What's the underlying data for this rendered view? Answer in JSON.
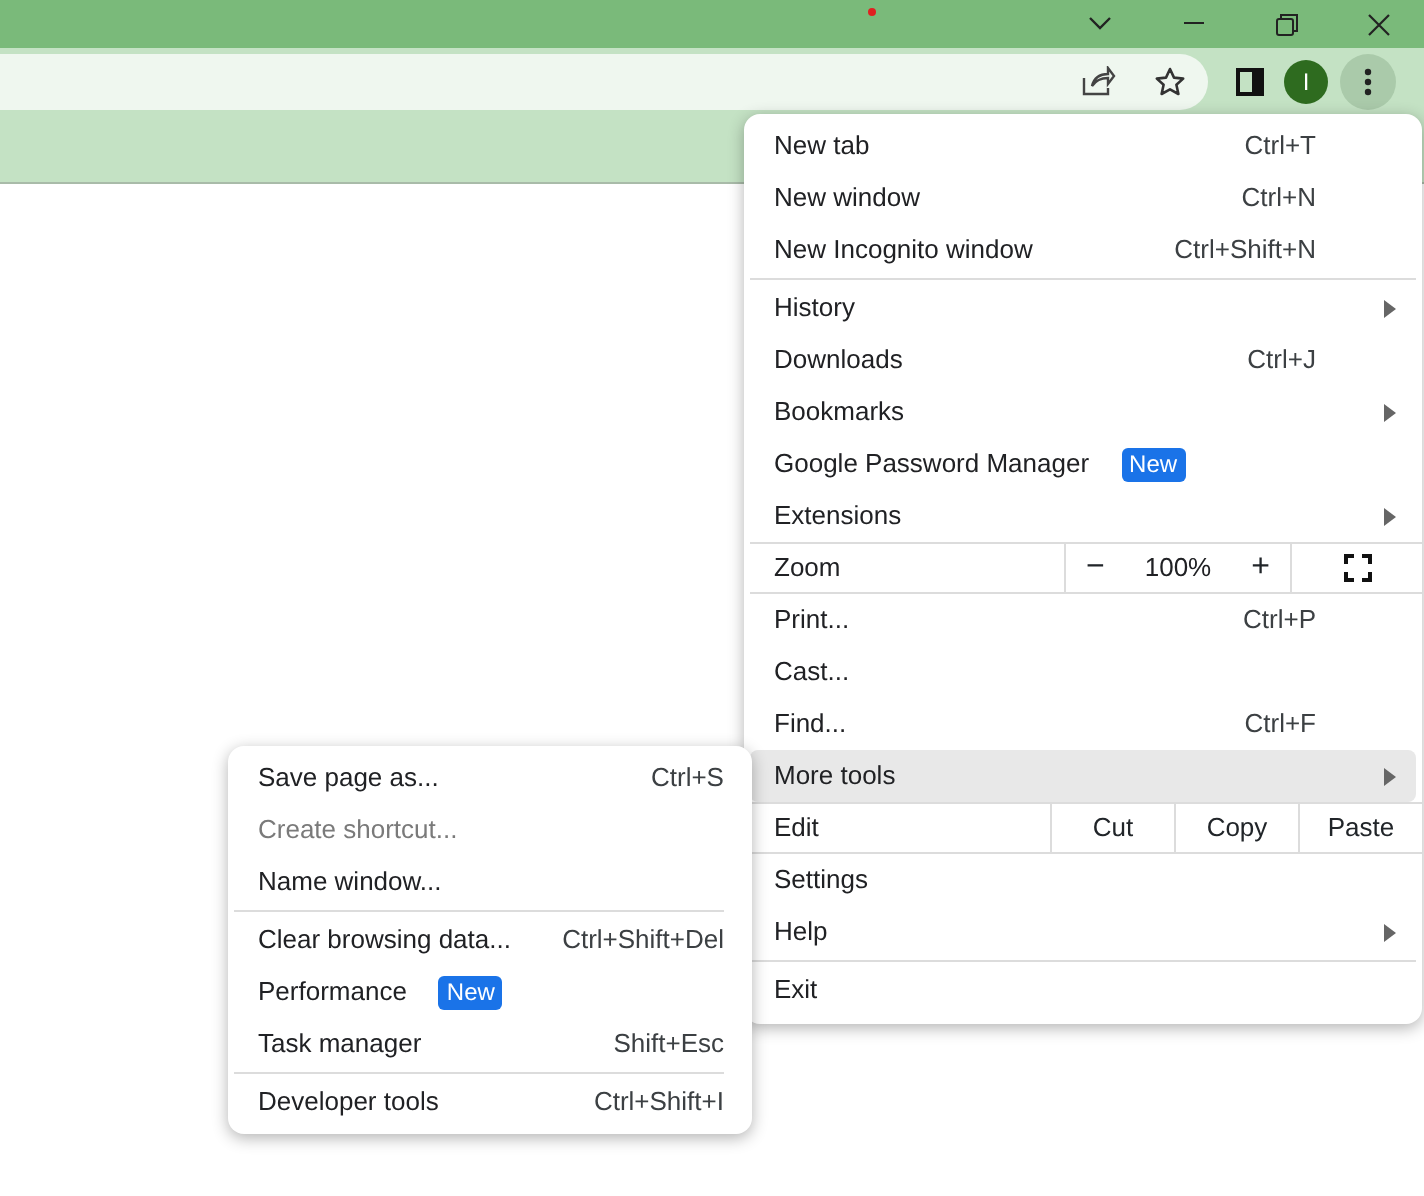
{
  "menu": {
    "items": [
      {
        "kind": "item",
        "label": "New tab",
        "shortcut": "Ctrl+T",
        "submenu": false,
        "highlighted": false
      },
      {
        "kind": "item",
        "label": "New window",
        "shortcut": "Ctrl+N",
        "submenu": false,
        "highlighted": false
      },
      {
        "kind": "item",
        "label": "New Incognito window",
        "shortcut": "Ctrl+Shift+N",
        "submenu": false,
        "highlighted": false
      },
      {
        "kind": "separator"
      },
      {
        "kind": "item",
        "label": "History",
        "submenu": true,
        "highlighted": false
      },
      {
        "kind": "item",
        "label": "Downloads",
        "shortcut": "Ctrl+J",
        "submenu": false,
        "highlighted": false
      },
      {
        "kind": "item",
        "label": "Bookmarks",
        "submenu": true,
        "highlighted": false
      },
      {
        "kind": "item",
        "label": "Google Password Manager",
        "badge": "New",
        "submenu": false,
        "highlighted": false
      },
      {
        "kind": "item",
        "label": "Extensions",
        "submenu": true,
        "highlighted": false
      },
      {
        "kind": "zoom",
        "label": "Zoom",
        "minus": "−",
        "value": "100%",
        "plus": "+"
      },
      {
        "kind": "item",
        "label": "Print...",
        "shortcut": "Ctrl+P",
        "submenu": false,
        "highlighted": false
      },
      {
        "kind": "item",
        "label": "Cast...",
        "submenu": false,
        "highlighted": false
      },
      {
        "kind": "item",
        "label": "Find...",
        "shortcut": "Ctrl+F",
        "submenu": false,
        "highlighted": false
      },
      {
        "kind": "item",
        "label": "More tools",
        "submenu": true,
        "highlighted": true
      },
      {
        "kind": "edit",
        "label": "Edit",
        "actions": [
          "Cut",
          "Copy",
          "Paste"
        ]
      },
      {
        "kind": "item",
        "label": "Settings",
        "submenu": false,
        "highlighted": false
      },
      {
        "kind": "item",
        "label": "Help",
        "submenu": true,
        "highlighted": false
      },
      {
        "kind": "separator"
      },
      {
        "kind": "item",
        "label": "Exit",
        "submenu": false,
        "highlighted": false
      }
    ]
  },
  "submenu": {
    "items": [
      {
        "kind": "item",
        "label": "Save page as...",
        "shortcut": "Ctrl+S",
        "disabled": false
      },
      {
        "kind": "item",
        "label": "Create shortcut...",
        "disabled": true
      },
      {
        "kind": "item",
        "label": "Name window...",
        "disabled": false
      },
      {
        "kind": "separator"
      },
      {
        "kind": "item",
        "label": "Clear browsing data...",
        "shortcut": "Ctrl+Shift+Del",
        "disabled": false
      },
      {
        "kind": "item",
        "label": "Performance",
        "badge": "New",
        "disabled": false
      },
      {
        "kind": "item",
        "label": "Task manager",
        "shortcut": "Shift+Esc",
        "disabled": false
      },
      {
        "kind": "separator"
      },
      {
        "kind": "item",
        "label": "Developer tools",
        "shortcut": "Ctrl+Shift+I",
        "disabled": false
      }
    ]
  },
  "profile": {
    "initial": "I"
  }
}
